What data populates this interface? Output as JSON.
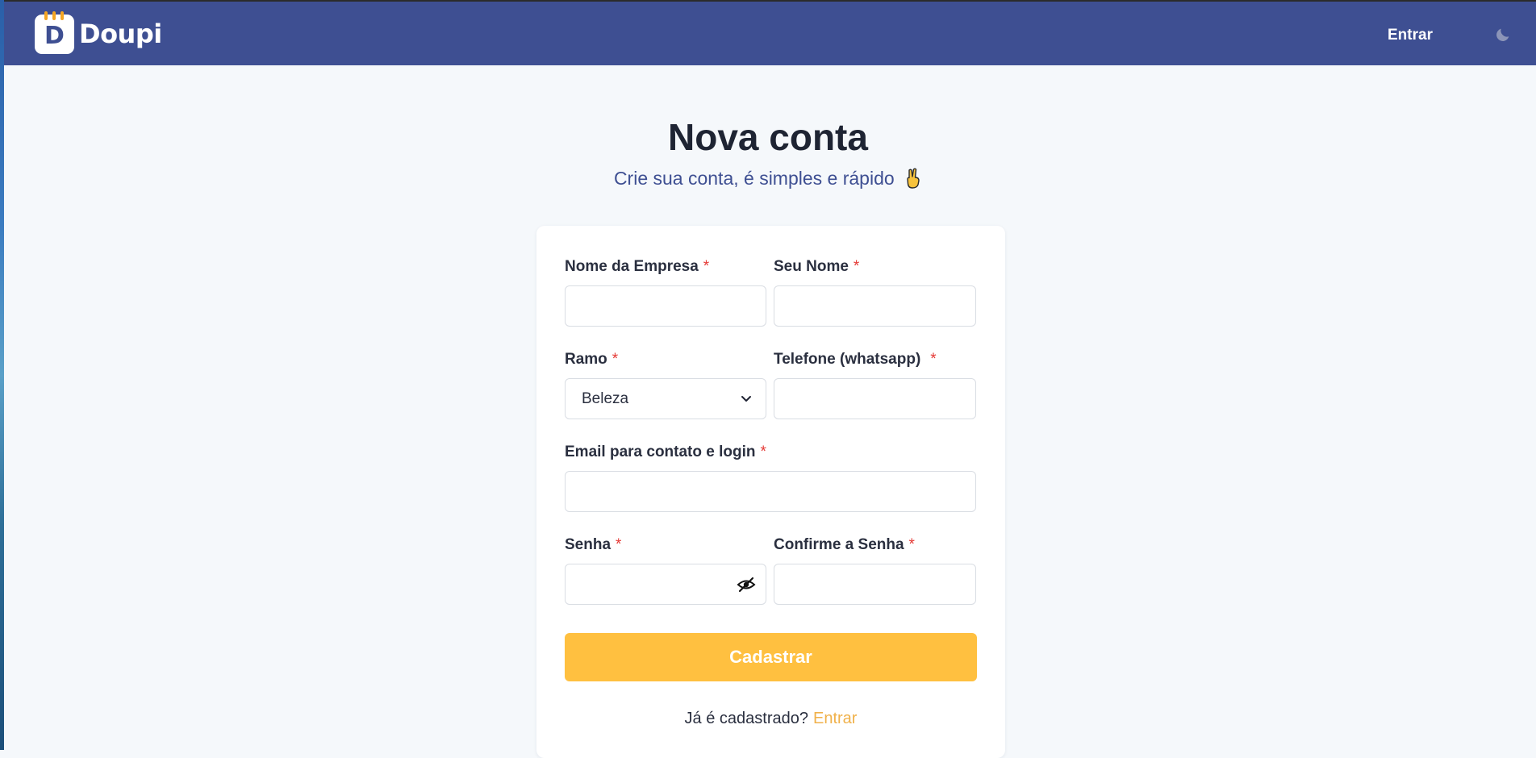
{
  "app": {
    "brand_letter": "D",
    "brand_name": "Doupi"
  },
  "header": {
    "login_label": "Entrar",
    "theme_icon": "moon-icon"
  },
  "page": {
    "title": "Nova conta",
    "subtitle": "Crie sua conta, é simples e rápido",
    "subtitle_icon": "victory-hand-icon"
  },
  "form": {
    "required_mark": "*",
    "company_name": {
      "label": "Nome da Empresa",
      "value": ""
    },
    "your_name": {
      "label": "Seu Nome",
      "value": ""
    },
    "branch": {
      "label": "Ramo",
      "selected": "Beleza"
    },
    "phone": {
      "label": "Telefone (whatsapp)",
      "value": ""
    },
    "email": {
      "label": "Email para contato e login",
      "value": ""
    },
    "password": {
      "label": "Senha",
      "value": "",
      "toggle_icon": "eye-off-icon"
    },
    "confirm_password": {
      "label": "Confirme a Senha",
      "value": ""
    },
    "submit_label": "Cadastrar",
    "already_registered": "Já é cadastrado?",
    "login_link": "Entrar"
  },
  "colors": {
    "header_bg": "#3e4f92",
    "accent": "#ffc040",
    "link": "#f0b14a",
    "required": "#e53935",
    "background": "#f5f8fb"
  }
}
